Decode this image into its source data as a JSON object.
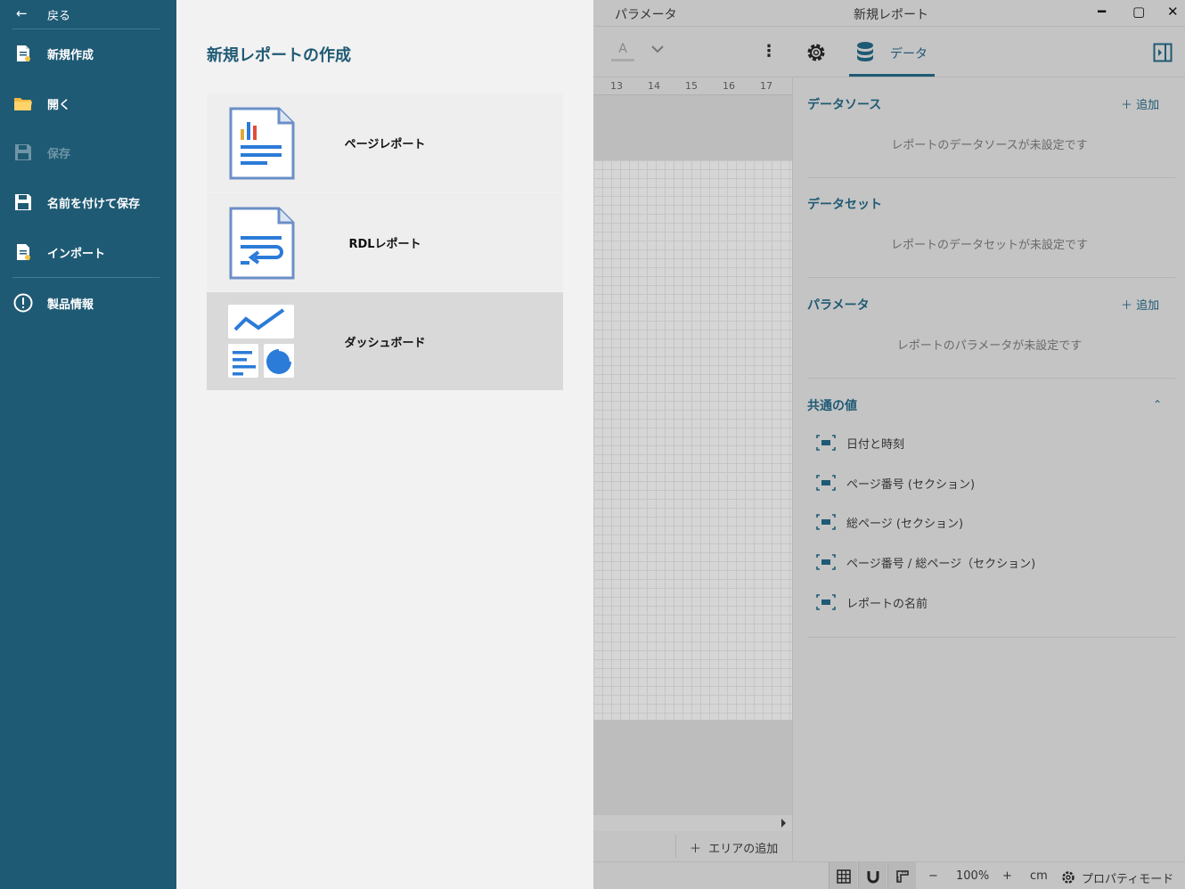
{
  "sidebar": {
    "back_label": "戻る",
    "items": [
      {
        "label": "新規作成",
        "icon": "new-document-icon",
        "disabled": false
      },
      {
        "label": "開く",
        "icon": "folder-icon",
        "disabled": false
      },
      {
        "label": "保存",
        "icon": "save-icon",
        "disabled": true
      },
      {
        "label": "名前を付けて保存",
        "icon": "save-as-icon",
        "disabled": false
      },
      {
        "label": "インポート",
        "icon": "import-icon",
        "disabled": false
      },
      {
        "label": "製品情報",
        "icon": "info-icon",
        "disabled": false
      }
    ]
  },
  "create": {
    "heading": "新規レポートの作成",
    "cards": [
      {
        "label": "ページレポート",
        "icon": "page-report-icon",
        "selected": false
      },
      {
        "label": "RDLレポート",
        "icon": "rdl-report-icon",
        "selected": false
      },
      {
        "label": "ダッシュボード",
        "icon": "dashboard-icon",
        "selected": true
      }
    ]
  },
  "window": {
    "left_title": "パラメータ",
    "title": "新規レポート"
  },
  "toolbar": {
    "font_letter": "A",
    "data_tab_label": "データ"
  },
  "ruler": [
    "13",
    "14",
    "15",
    "16",
    "17"
  ],
  "canvas": {
    "add_area_label": "エリアの追加"
  },
  "data_panel": {
    "add_label": "追加",
    "datasource": {
      "title": "データソース",
      "empty": "レポートのデータソースが未設定です"
    },
    "dataset": {
      "title": "データセット",
      "empty": "レポートのデータセットが未設定です"
    },
    "parameters": {
      "title": "パラメータ",
      "empty": "レポートのパラメータが未設定です"
    },
    "common_values": {
      "title": "共通の値",
      "items": [
        "日付と時刻",
        "ページ番号 (セクション)",
        "総ページ (セクション)",
        "ページ番号 / 総ページ（セクション)",
        "レポートの名前"
      ]
    }
  },
  "statusbar": {
    "minus": "−",
    "zoom": "100%",
    "plus": "+",
    "unit": "cm",
    "property_mode": "プロパティモード"
  },
  "colors": {
    "sidebar_bg": "#1f5a74",
    "accent": "#1f5a74",
    "doc_blue": "#2b7bd8"
  }
}
